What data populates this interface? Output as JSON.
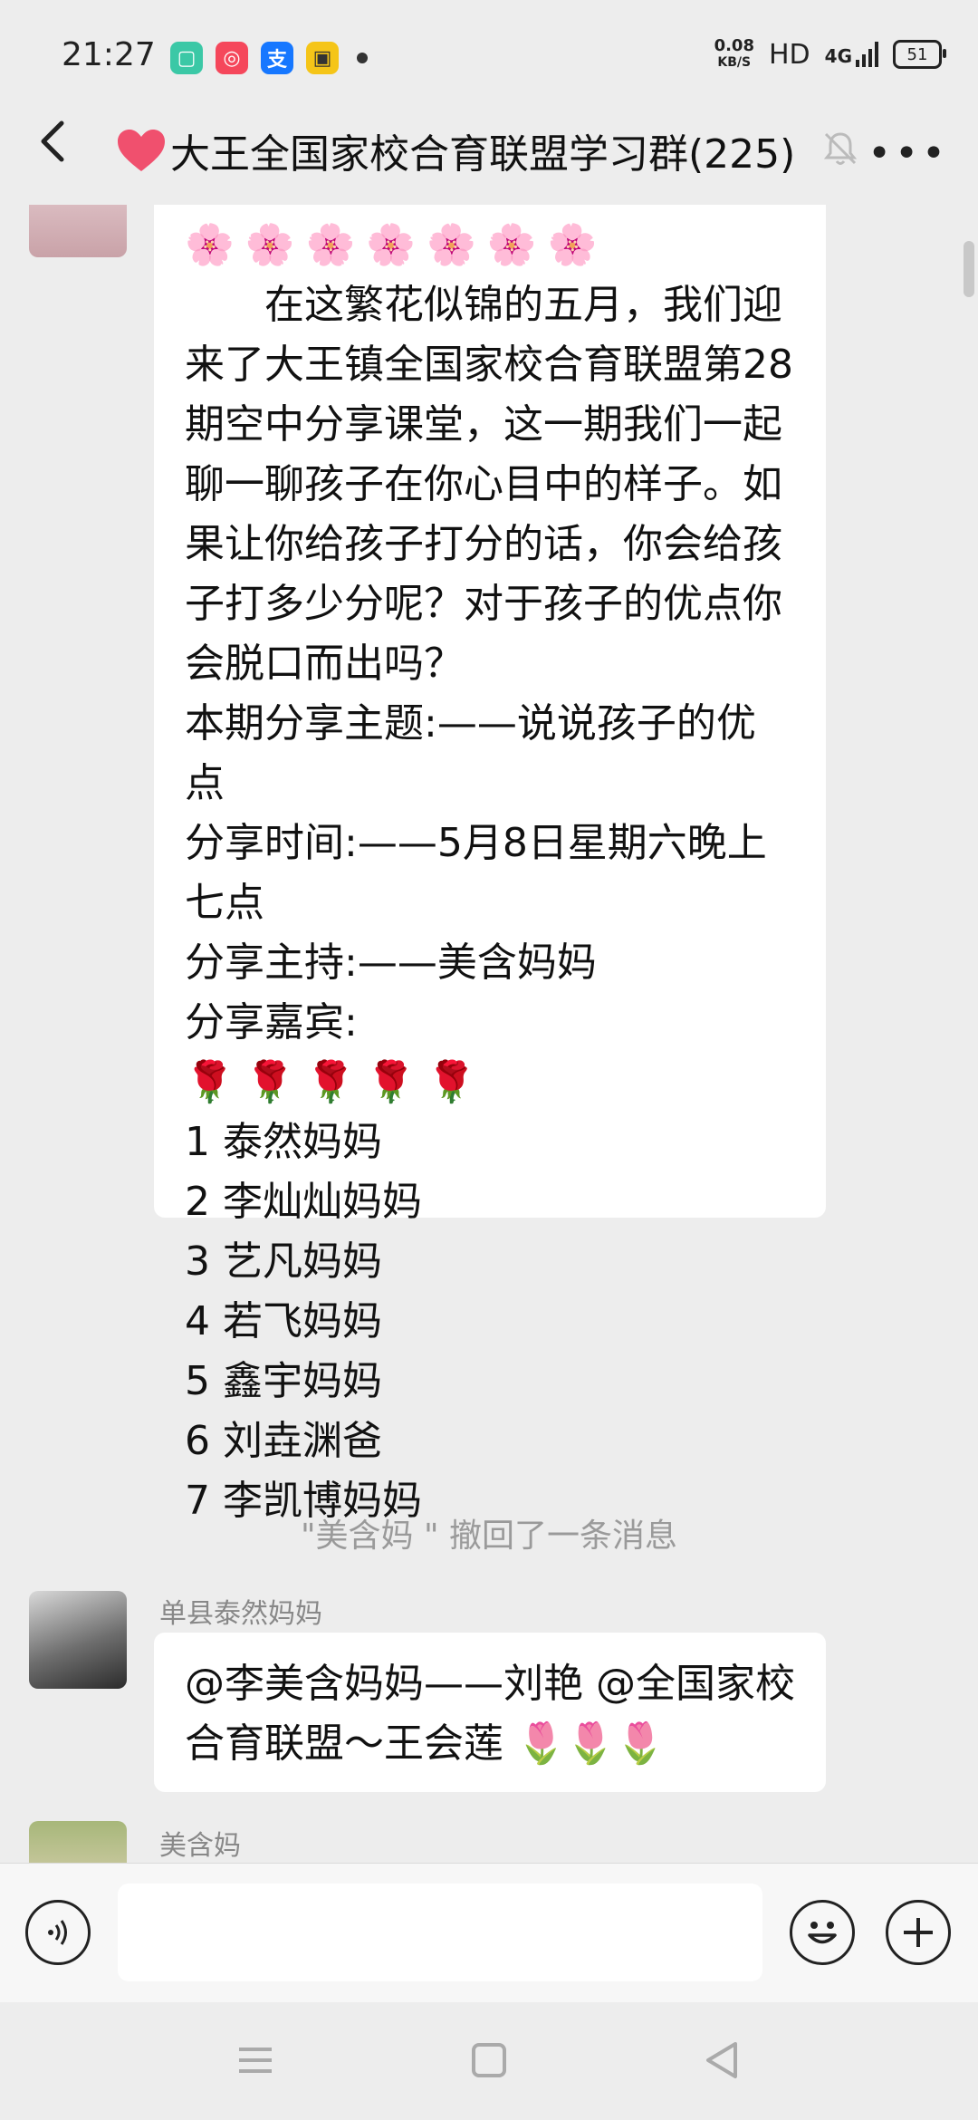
{
  "status": {
    "time": "21:27",
    "speed_value": "0.08",
    "speed_unit": "KB/S",
    "hd": "HD",
    "network": "4G",
    "battery": "51"
  },
  "header": {
    "title": "大王全国家校合育联盟学习群(225)"
  },
  "messages": {
    "first": {
      "flowers": "🌸🌸🌸🌸🌸🌸🌸",
      "para1": "在这繁花似锦的五月，我们迎来了大王镇全国家校合育联盟第28期空中分享课堂，这一期我们一起聊一聊孩子在你心目中的样子。如果让你给孩子打分的话，你会给孩子打多少分呢？对于孩子的优点你会脱口而出吗？",
      "theme": "本期分享主题:——说说孩子的优点",
      "time": "分享时间:——5月8日星期六晚上七点",
      "host": "分享主持:——美含妈妈",
      "guests_label": "分享嘉宾:",
      "roses": "🌹🌹🌹🌹🌹",
      "guests": [
        "1 泰然妈妈",
        "2 李灿灿妈妈",
        "3 艺凡妈妈",
        "4 若飞妈妈",
        "5 鑫宇妈妈",
        "6 刘垚渊爸",
        "7 李凯博妈妈"
      ]
    },
    "recall_notice": "\"美含妈 \" 撤回了一条消息",
    "second": {
      "sender": "单县泰然妈妈",
      "text": "@李美含妈妈——刘艳 @全国家校合育联盟～王会莲",
      "tulips": "🌷🌷🌷"
    },
    "third": {
      "sender": "美含妈"
    }
  },
  "input": {
    "placeholder": ""
  },
  "icons": [
    "back-icon",
    "heart-icon",
    "mute-icon",
    "more-icon",
    "voice-icon",
    "emoji-icon",
    "add-icon",
    "menu-icon",
    "home-icon",
    "back-triangle-icon"
  ]
}
